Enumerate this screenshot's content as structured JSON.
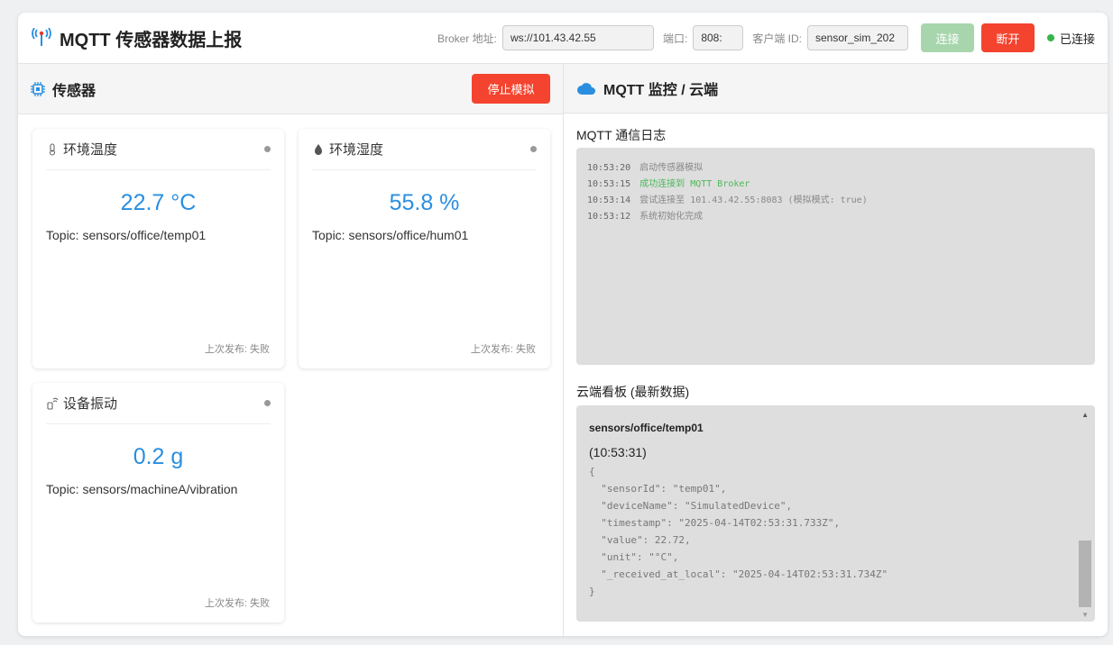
{
  "header": {
    "title": "MQTT 传感器数据上报",
    "broker_label": "Broker 地址:",
    "broker_value": "ws://101.43.42.55",
    "port_label": "端口:",
    "port_value": "808:",
    "client_label": "客户端 ID:",
    "client_value": "sensor_sim_202",
    "connect_label": "连接",
    "disconnect_label": "断开",
    "status_text": "已连接"
  },
  "sensors": {
    "title": "传感器",
    "stop_label": "停止模拟",
    "cards": [
      {
        "name": "环境温度",
        "icon": "thermometer-icon",
        "value": "22.7 °C",
        "topic": "Topic: sensors/office/temp01",
        "footer": "上次发布: 失败"
      },
      {
        "name": "环境湿度",
        "icon": "droplet-icon",
        "value": "55.8 %",
        "topic": "Topic: sensors/office/hum01",
        "footer": "上次发布: 失败"
      },
      {
        "name": "设备振动",
        "icon": "vibration-icon",
        "value": "0.2 g",
        "topic": "Topic: sensors/machineA/vibration",
        "footer": "上次发布: 失败"
      }
    ]
  },
  "monitor": {
    "title": "MQTT 监控 / 云端",
    "log_title": "MQTT 通信日志",
    "log": [
      {
        "time": "10:53:20",
        "msg": "启动传感器模拟",
        "ok": false
      },
      {
        "time": "10:53:15",
        "msg": "成功连接到 MQTT Broker",
        "ok": true
      },
      {
        "time": "10:53:14",
        "msg": "尝试连接至 101.43.42.55:8083 (模拟模式: true)",
        "ok": false
      },
      {
        "time": "10:53:12",
        "msg": "系统初始化完成",
        "ok": false
      }
    ],
    "dashboard_title": "云端看板 (最新数据)",
    "dashboard_topic": "sensors/office/temp01",
    "dashboard_time": "(10:53:31)",
    "json_lines": [
      "{",
      "  \"sensorId\": \"temp01\",",
      "  \"deviceName\": \"SimulatedDevice\",",
      "  \"timestamp\": \"2025-04-14T02:53:31.733Z\",",
      "  \"value\": 22.72,",
      "  \"unit\": \"°C\",",
      "  \"_received_at_local\": \"2025-04-14T02:53:31.734Z\"",
      "}"
    ]
  },
  "colors": {
    "accent_blue": "#2a8ee0",
    "danger_red": "#f4432e",
    "connect_disabled": "#a7d6ad",
    "status_green": "#38b54a"
  }
}
